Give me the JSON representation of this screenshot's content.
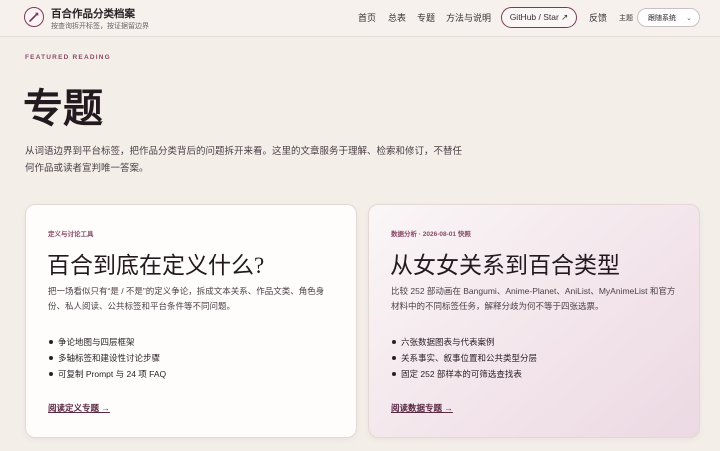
{
  "header": {
    "brand_title": "百合作品分类档案",
    "brand_subtitle": "按查询拆开标签，按证据留边界",
    "nav": [
      "首页",
      "总表",
      "专题",
      "方法与说明"
    ],
    "github_button": "GitHub / Star ↗",
    "feedback": "反馈",
    "theme_label": "主题",
    "theme_value": "跟随系统"
  },
  "hero": {
    "eyebrow": "FEATURED READING",
    "title": "专题",
    "intro": "从词语边界到平台标签，把作品分类背后的问题拆开来看。这里的文章服务于理解、检索和修订，不替任何作品或读者宣判唯一答案。"
  },
  "cards": [
    {
      "kicker": "定义与讨论工具",
      "title": "百合到底在定义什么?",
      "description": "把一场看似只有“是 / 不是”的定义争论，拆成文本关系、作品文类、角色身份、私人阅读、公共标签和平台条件等不同问题。",
      "bullets": [
        "争论地图与四层框架",
        "多轴标签和建设性讨论步骤",
        "可复制 Prompt 与 24 项 FAQ"
      ],
      "cta": "阅读定义专题 →"
    },
    {
      "kicker": "数据分析 · 2026-08-01 快照",
      "title": "从女女关系到百合类型",
      "description": "比较 252 部动画在 Bangumi、Anime-Planet、AniList、MyAnimeList 和官方材料中的不同标签任务，解释分歧为何不等于四张选票。",
      "bullets": [
        "六张数据图表与代表案例",
        "关系事实、叙事位置和公共类型分层",
        "固定 252 部样本的可筛选查找表"
      ],
      "cta": "阅读数据专题 →"
    }
  ]
}
